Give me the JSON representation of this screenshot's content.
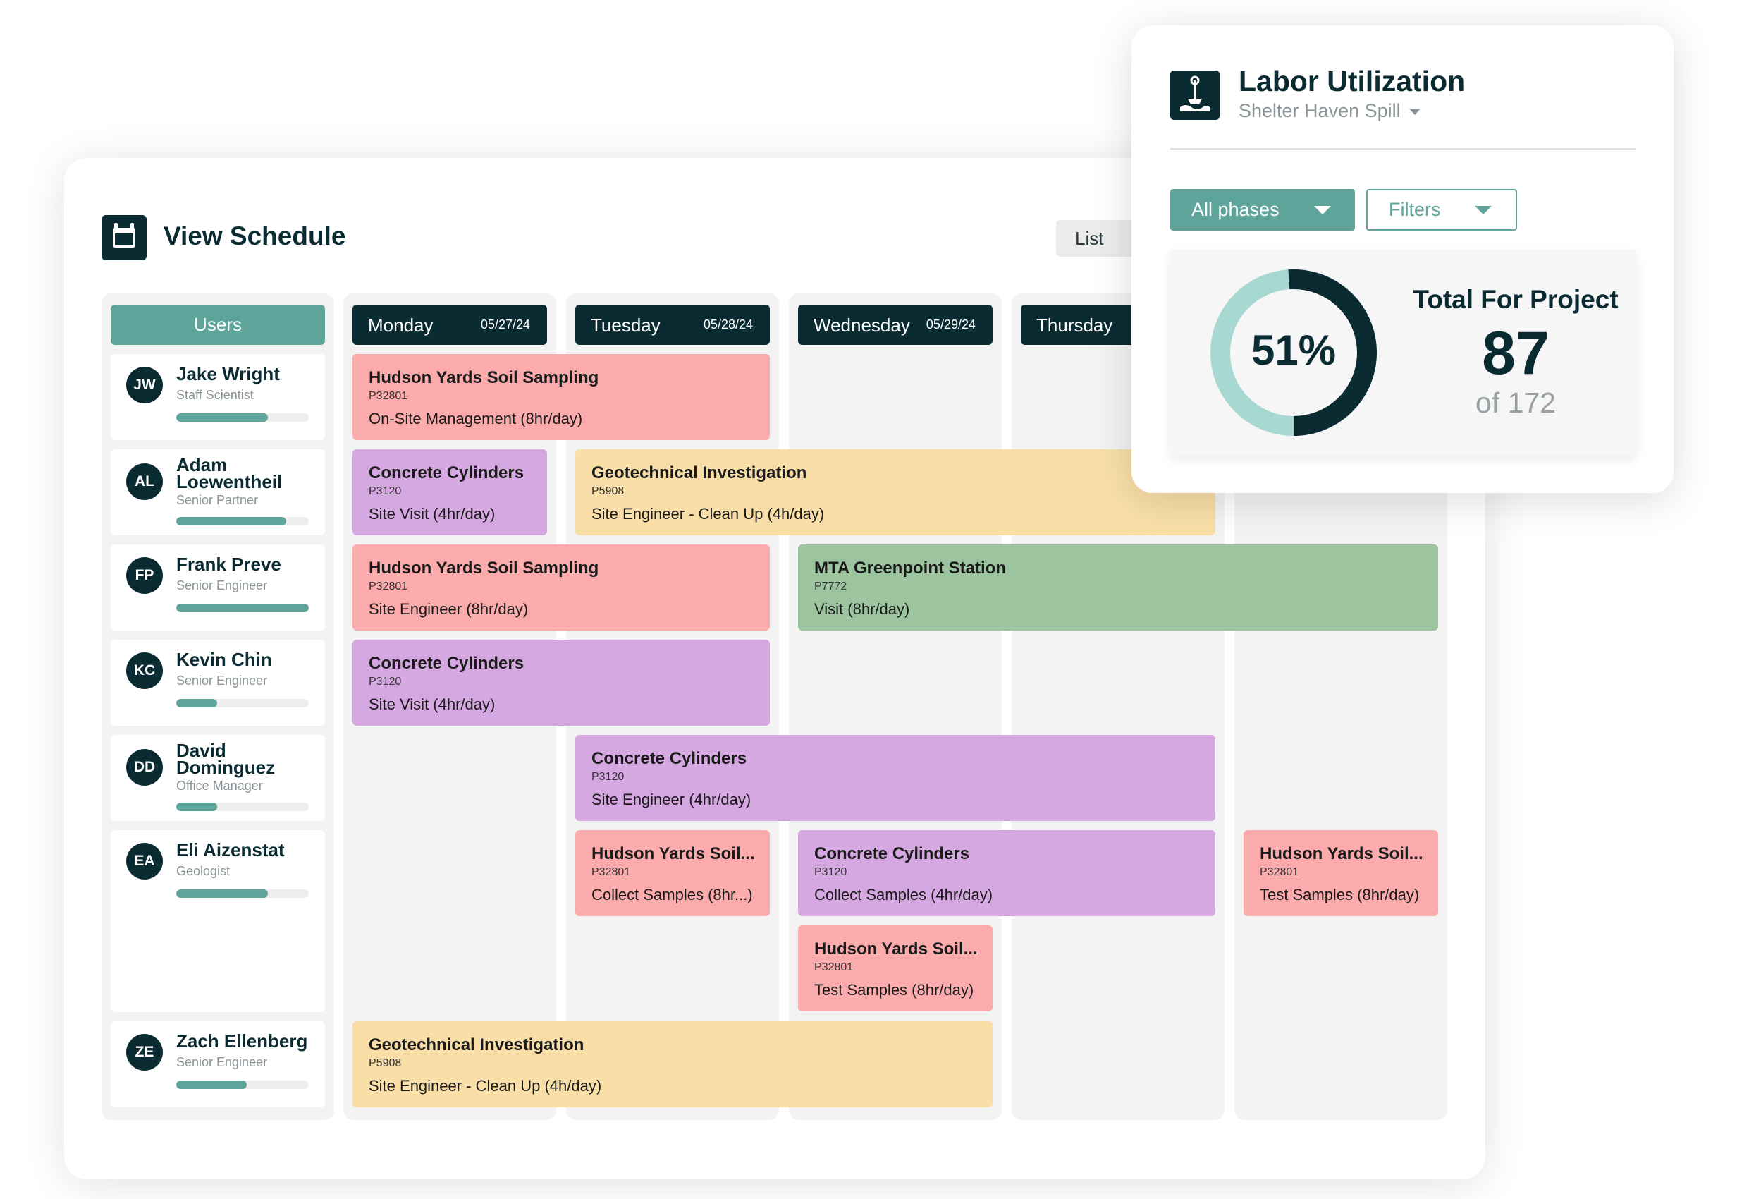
{
  "schedule": {
    "title": "View Schedule",
    "list_label": "List",
    "users_header": "Users",
    "days": [
      {
        "name": "Monday",
        "date": "05/27/24"
      },
      {
        "name": "Tuesday",
        "date": "05/28/24"
      },
      {
        "name": "Wednesday",
        "date": "05/29/24"
      },
      {
        "name": "Thursday",
        "date": ""
      }
    ],
    "users": [
      {
        "initials": "JW",
        "name": "Jake Wright",
        "role": "Staff Scientist",
        "utilization": 0.69
      },
      {
        "initials": "AL",
        "name": "Adam Loewentheil",
        "role": "Senior Partner",
        "utilization": 0.83
      },
      {
        "initials": "FP",
        "name": "Frank Preve",
        "role": "Senior Engineer",
        "utilization": 1.0
      },
      {
        "initials": "KC",
        "name": "Kevin Chin",
        "role": "Senior Engineer",
        "utilization": 0.31
      },
      {
        "initials": "DD",
        "name": "David Dominguez",
        "role": "Office Manager",
        "utilization": 0.31
      },
      {
        "initials": "EA",
        "name": "Eli Aizenstat",
        "role": "Geologist",
        "utilization": 0.69
      },
      {
        "initials": "ZE",
        "name": "Zach Ellenberg",
        "role": "Senior Engineer",
        "utilization": 0.53
      }
    ],
    "events": [
      {
        "title": "Hudson Yards Soil Sampling",
        "code": "P32801",
        "desc": "On-Site Management (8hr/day)"
      },
      {
        "title": "Concrete Cylinders",
        "code": "P3120",
        "desc": "Site Visit (4hr/day)"
      },
      {
        "title": "Geotechnical Investigation",
        "code": "P5908",
        "desc": "Site Engineer - Clean Up (4h/day)"
      },
      {
        "title": "Hudson Yards Soil Sampling",
        "code": "P32801",
        "desc": "Site Engineer (8hr/day)"
      },
      {
        "title": "MTA Greenpoint Station",
        "code": "P7772",
        "desc": "Visit (8hr/day)"
      },
      {
        "title": "Concrete Cylinders",
        "code": "P3120",
        "desc": "Site Visit (4hr/day)"
      },
      {
        "title": "Concrete Cylinders",
        "code": "P3120",
        "desc": "Site Engineer (4hr/day)"
      },
      {
        "title": "Hudson Yards Soil...",
        "code": "P32801",
        "desc": "Collect Samples (8hr...)"
      },
      {
        "title": "Concrete Cylinders",
        "code": "P3120",
        "desc": "Collect Samples (4hr/day)"
      },
      {
        "title": "Hudson Yards Soil...",
        "code": "P32801",
        "desc": "Test Samples (8hr/day)"
      },
      {
        "title": "Hudson Yards Soil...",
        "code": "P32801",
        "desc": "Test Samples (8hr/day)"
      },
      {
        "title": "Geotechnical Investigation",
        "code": "P5908",
        "desc": "Site Engineer - Clean Up (4h/day)"
      }
    ]
  },
  "labor": {
    "title": "Labor Utilization",
    "project": "Shelter Haven Spill",
    "phases_label": "All phases",
    "filters_label": "Filters",
    "percent_label": "51%",
    "percent": 0.51,
    "total_label": "Total For Project",
    "total_value": "87",
    "total_of": "of 172"
  },
  "colors": {
    "navy": "#0b2b33",
    "teal": "#5fa49a",
    "teal_light": "#a8d8d2",
    "event_pink": "#fbabab",
    "event_purple": "#d6a8e2",
    "event_yellow": "#f9dfa7",
    "event_green": "#9cc49e"
  }
}
